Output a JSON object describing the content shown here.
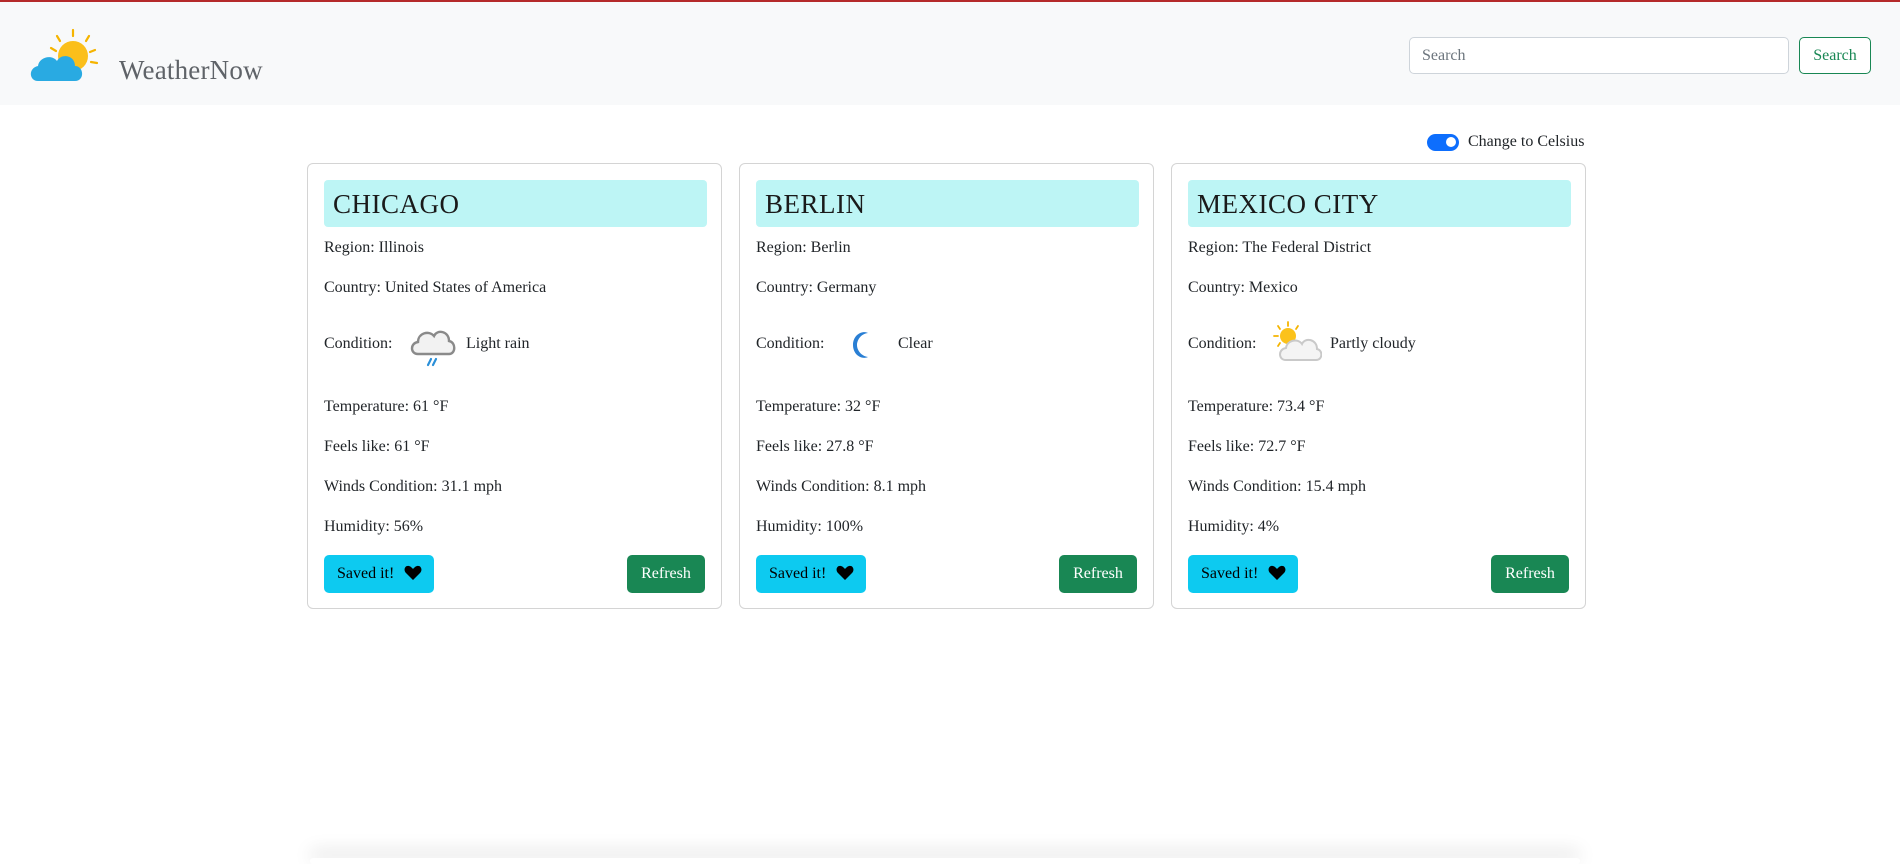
{
  "app": {
    "brand": "WeatherNow",
    "logo_icon": "sun-behind-cloud-icon",
    "accent_color": "#198754",
    "top_line_color": "#b52a2a"
  },
  "search": {
    "placeholder": "Search",
    "button_label": "Search"
  },
  "unit_toggle": {
    "label": "Change to Celsius",
    "checked": true
  },
  "cards": [
    {
      "city": "CHICAGO",
      "region": "Region: Illinois",
      "country": "Country: United States of America",
      "condition_label": "Condition:",
      "condition_icon": "light-rain-icon",
      "condition": "Light rain",
      "temperature": "Temperature: 61 °F",
      "feels_like": "Feels like: 61 °F",
      "wind": "Winds Condition: 31.1 mph",
      "humidity": "Humidity: 56%",
      "save_label": "Saved it!",
      "refresh_label": "Refresh"
    },
    {
      "city": "BERLIN",
      "region": "Region: Berlin",
      "country": "Country: Germany",
      "condition_label": "Condition:",
      "condition_icon": "clear-night-moon-icon",
      "condition": "Clear",
      "temperature": "Temperature: 32 °F",
      "feels_like": "Feels like: 27.8 °F",
      "wind": "Winds Condition: 8.1 mph",
      "humidity": "Humidity: 100%",
      "save_label": "Saved it!",
      "refresh_label": "Refresh"
    },
    {
      "city": "MEXICO CITY",
      "region": "Region: The Federal District",
      "country": "Country: Mexico",
      "condition_label": "Condition:",
      "condition_icon": "partly-cloudy-icon",
      "condition": "Partly cloudy",
      "temperature": "Temperature: 73.4 °F",
      "feels_like": "Feels like: 72.7 °F",
      "wind": "Winds Condition: 15.4 mph",
      "humidity": "Humidity: 4%",
      "save_label": "Saved it!",
      "refresh_label": "Refresh"
    }
  ]
}
